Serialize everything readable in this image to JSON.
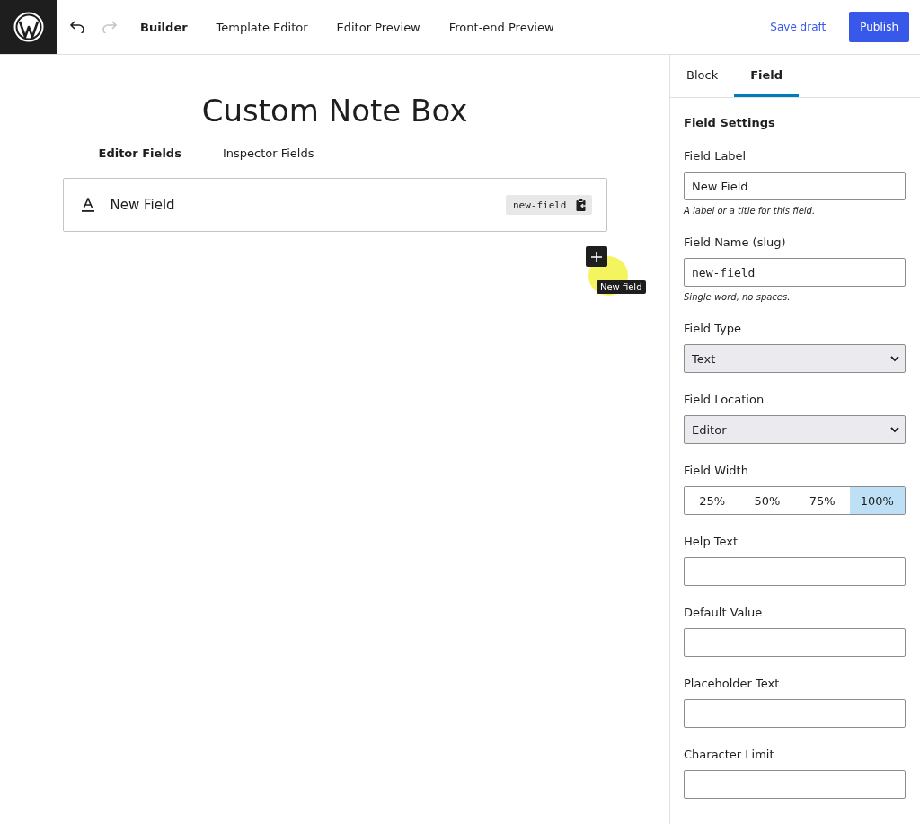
{
  "toolbar": {
    "nav": [
      {
        "label": "Builder",
        "selected": true
      },
      {
        "label": "Template Editor",
        "selected": false
      },
      {
        "label": "Editor Preview",
        "selected": false
      },
      {
        "label": "Front-end Preview",
        "selected": false
      }
    ],
    "undo_disabled": false,
    "redo_disabled": true,
    "save_draft": "Save draft",
    "publish": "Publish"
  },
  "canvas": {
    "title": "Custom Note Box",
    "tabs": [
      {
        "label": "Editor Fields",
        "selected": true
      },
      {
        "label": "Inspector Fields",
        "selected": false
      }
    ],
    "fields": [
      {
        "label": "New Field",
        "slug": "new-field"
      }
    ],
    "add_tooltip": "New field"
  },
  "sidebar": {
    "tabs": [
      {
        "label": "Block",
        "selected": false
      },
      {
        "label": "Field",
        "selected": true
      }
    ],
    "section_title": "Field Settings",
    "settings": [
      {
        "kind": "input",
        "label": "Field Label",
        "value": "New Field",
        "hint": "A label or a title for this field.",
        "mono": false
      },
      {
        "kind": "input",
        "label": "Field Name (slug)",
        "value": "new-field",
        "hint": "Single word, no spaces.",
        "mono": true
      },
      {
        "kind": "select",
        "label": "Field Type",
        "value": "Text"
      },
      {
        "kind": "select",
        "label": "Field Location",
        "value": "Editor"
      },
      {
        "kind": "segmented",
        "label": "Field Width",
        "options": [
          {
            "label": "25%",
            "selected": false
          },
          {
            "label": "50%",
            "selected": false
          },
          {
            "label": "75%",
            "selected": false
          },
          {
            "label": "100%",
            "selected": true
          }
        ]
      },
      {
        "kind": "input",
        "label": "Help Text"
      },
      {
        "kind": "input",
        "label": "Default Value"
      },
      {
        "kind": "input",
        "label": "Placeholder Text"
      },
      {
        "kind": "input",
        "label": "Character Limit"
      }
    ]
  }
}
